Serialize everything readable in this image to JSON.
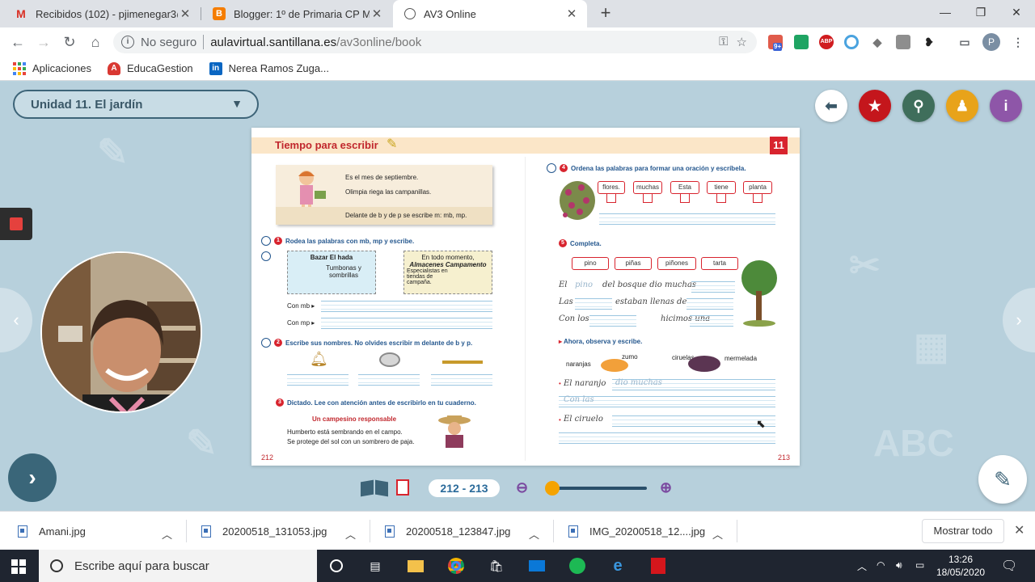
{
  "browser": {
    "tabs": [
      {
        "title": "Recibidos (102) - pjimenegar3@e",
        "icon": "gmail-icon"
      },
      {
        "title": "Blogger: 1º de Primaria CP Mont",
        "icon": "blogger-icon"
      },
      {
        "title": "AV3 Online",
        "icon": "globe-icon"
      }
    ],
    "address": {
      "security": "No seguro",
      "host": "aulavirtual.santillana.es",
      "path": "/av3online/book"
    },
    "bookmarks": [
      {
        "label": "Aplicaciones"
      },
      {
        "label": "EducaGestion"
      },
      {
        "label": "Nerea Ramos Zuga..."
      }
    ],
    "profile_initial": "P",
    "ext_badge": "9+",
    "ext_abp": "ABP"
  },
  "app": {
    "unit_selector": "Unidad 11. El jardín",
    "colors": {
      "back": "#ffffff",
      "star": "#c4161c",
      "search": "#3f6e5b",
      "person": "#e8a31a",
      "info": "#8e56a8"
    },
    "pager_label": "212 - 213"
  },
  "book": {
    "title": "Tiempo para escribir",
    "unit_number": "11",
    "left_page": "212",
    "right_page": "213",
    "intro": {
      "line1": "Es el mes de septiembre.",
      "line2": "Olimpia riega las campanillas.",
      "rule": "Delante de b y de p se escribe m: mb, mp."
    },
    "ex1": {
      "num": "1",
      "text": "Rodea las palabras con mb, mp y escribe.",
      "sign1_title": "Bazar El hada",
      "sign1_text": "Tumbonas y sombrillas",
      "sign2_line1": "En todo momento,",
      "sign2_line2": "Almacenes Campamento",
      "sign2_line3": "Especialistas en tiendas de campaña.",
      "with_mb": "Con mb ▸",
      "with_mp": "Con mp ▸"
    },
    "ex2": {
      "num": "2",
      "text": "Escribe sus nombres. No olvides escribir m delante de b y p."
    },
    "ex3": {
      "num": "3",
      "text": "Dictado. Lee con atención antes de escribirlo en tu cuaderno.",
      "story_title": "Un campesino responsable",
      "story_line1": "Humberto está sembrando en el campo.",
      "story_line2": "Se protege del sol con un sombrero de paja."
    },
    "ex4": {
      "num": "4",
      "text": "Ordena las palabras para formar una oración y escríbela.",
      "words": [
        "flores.",
        "muchas",
        "Esta",
        "tiene",
        "planta"
      ]
    },
    "ex5": {
      "num": "5",
      "text": "Completa.",
      "words": [
        "pino",
        "piñas",
        "piñones",
        "tarta"
      ],
      "line1_a": "El",
      "line1_fill": "pino",
      "line1_b": "del bosque dio muchas",
      "line2_a": "Las",
      "line2_b": "estaban llenas de",
      "line3_a": "Con los",
      "line3_b": "hicimos una",
      "sub": "Ahora, observa y escribe.",
      "fruit1": "naranjas",
      "fruit1b": "zumo",
      "fruit2": "ciruelas",
      "fruit2b": "mermelada",
      "w_line1": "El naranjo",
      "w_line1_fill": "dio muchas",
      "w_line2_fill": "Con las",
      "w_line3": "El ciruelo"
    }
  },
  "downloads": {
    "items": [
      "Amani.jpg",
      "20200518_131053.jpg",
      "20200518_123847.jpg",
      "IMG_20200518_12....jpg"
    ],
    "show_all": "Mostrar todo"
  },
  "taskbar": {
    "search_placeholder": "Escribe aquí para buscar",
    "time": "13:26",
    "date": "18/05/2020"
  }
}
